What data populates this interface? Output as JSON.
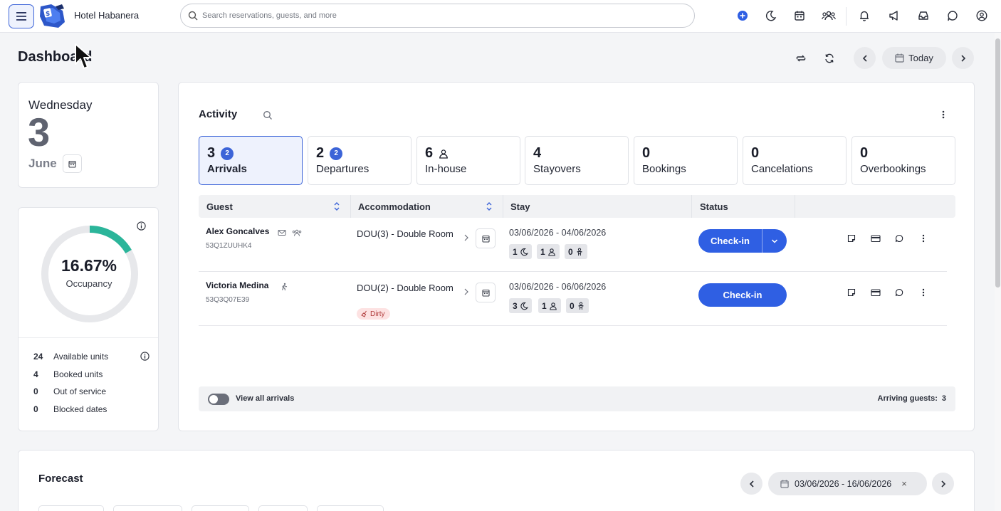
{
  "topbar": {
    "hotel_name": "Hotel Habanera",
    "search_placeholder": "Search reservations, guests, and more"
  },
  "header": {
    "title": "Dashboard",
    "today_label": "Today"
  },
  "date_card": {
    "weekday": "Wednesday",
    "day": "3",
    "month": "June"
  },
  "occupancy": {
    "value_label": "16.67%",
    "fraction": 0.1667,
    "label": "Occupancy",
    "stats": [
      {
        "num": "24",
        "label": "Available units"
      },
      {
        "num": "4",
        "label": "Booked units"
      },
      {
        "num": "0",
        "label": "Out of service"
      },
      {
        "num": "0",
        "label": "Blocked dates"
      }
    ]
  },
  "activity": {
    "title": "Activity",
    "tabs": [
      {
        "num": "3",
        "badge": "2",
        "label": "Arrivals"
      },
      {
        "num": "2",
        "badge": "2",
        "label": "Departures"
      },
      {
        "num": "6",
        "label": "In-house"
      },
      {
        "num": "4",
        "label": "Stayovers"
      },
      {
        "num": "0",
        "label": "Bookings"
      },
      {
        "num": "0",
        "label": "Cancelations"
      },
      {
        "num": "0",
        "label": "Overbookings"
      }
    ],
    "columns": {
      "guest": "Guest",
      "accommodation": "Accommodation",
      "stay": "Stay",
      "status": "Status"
    },
    "rows": [
      {
        "guest": "Alex Goncalves",
        "code": "53Q1ZUUHK4",
        "accommodation": "DOU(3) - Double Room",
        "dates": "03/06/2026 - 04/06/2026",
        "nights": "1",
        "adults": "1",
        "children": "0",
        "action": "Check-in"
      },
      {
        "guest": "Victoria Medina",
        "code": "53Q3Q07E39",
        "accommodation": "DOU(2) - Double Room",
        "housekeeping": "Dirty",
        "dates": "03/06/2026 - 06/06/2026",
        "nights": "3",
        "adults": "1",
        "children": "0",
        "action": "Check-in"
      }
    ],
    "footer": {
      "toggle_label": "View all arrivals",
      "arriving_label": "Arriving guests:",
      "arriving_count": "3"
    }
  },
  "forecast": {
    "title": "Forecast",
    "date_range": "03/06/2026 - 16/06/2026"
  },
  "colors": {
    "accent": "#2f5fe3",
    "occupancy_arc": "#2bb59a",
    "dirty_bg": "#fde2e2"
  }
}
